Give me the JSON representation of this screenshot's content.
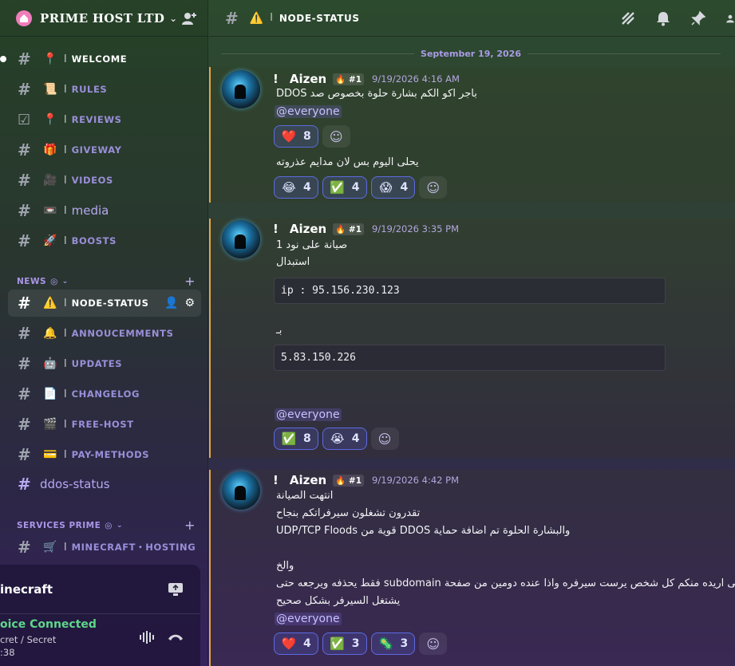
{
  "server": {
    "name": "PRIME HOST LTD"
  },
  "sidebar": {
    "channels_top": [
      {
        "emoji": "📍",
        "label": "WELCOME",
        "style": "bright",
        "unread": true
      },
      {
        "emoji": "📜",
        "label": "RULES"
      },
      {
        "emoji": "📍",
        "label": "REVIEWS",
        "icon": "checklist"
      },
      {
        "emoji": "🎁",
        "label": "GIVEWAY"
      },
      {
        "emoji": "🎥",
        "label": "VIDEOS"
      },
      {
        "emoji": "📼",
        "label": "media",
        "plain": true
      },
      {
        "emoji": "🚀",
        "label": "BOOSTS"
      }
    ],
    "category_news": "NEWS",
    "channels_news": [
      {
        "emoji": "⚠️",
        "label": "NODE-STATUS",
        "active": true
      },
      {
        "emoji": "🔔",
        "label": "ANNOUCEMMENTS"
      },
      {
        "emoji": "🤖",
        "label": "UPDATES"
      },
      {
        "emoji": "📄",
        "label": "CHANGELOG"
      },
      {
        "emoji": "🎬",
        "label": "FREE-HOST"
      },
      {
        "emoji": "💳",
        "label": "PAY-METHODS"
      }
    ],
    "ddos_channel": "ddos-status",
    "category_services": "SERVICES PRIME",
    "channel_minecraft": {
      "emoji": "🛒",
      "label": "MINECRAFT・HOSTING"
    }
  },
  "voice": {
    "title": "inecraft",
    "status": "oice Connected",
    "sub": "cret / Secret",
    "time": ":38"
  },
  "topbar": {
    "channel": "NODE-STATUS"
  },
  "date_separator": "September 19, 2026",
  "messages": [
    {
      "author": "Aizen",
      "tag": "🔥 #1",
      "time": "9/19/2026 4:16 AM",
      "line1": "باجر اكو الكم بشارة حلوة بخصوص صد DDOS",
      "mention": "@everyone",
      "reactions1": [
        {
          "emoji": "❤️",
          "count": "8"
        }
      ],
      "line2": "يحلى اليوم بس لان مدايم عذروته",
      "reactions2": [
        {
          "emoji": "😂",
          "count": "4"
        },
        {
          "emoji": "✅",
          "count": "4"
        },
        {
          "emoji": "😱",
          "count": "4"
        }
      ]
    },
    {
      "author": "Aizen",
      "tag": "🔥 #1",
      "time": "9/19/2026 3:35 PM",
      "line1": "صيانة على نود 1",
      "line2": "استبدال",
      "code1": "ip : 95.156.230.123",
      "line3": "بـ",
      "code2": "5.83.150.226",
      "mention": "@everyone",
      "reactions": [
        {
          "emoji": "✅",
          "count": "8"
        },
        {
          "emoji": "😭",
          "count": "4"
        }
      ]
    },
    {
      "author": "Aizen",
      "tag": "🔥 #1",
      "time": "9/19/2026 4:42 PM",
      "line1": "انتهت الصيانة",
      "line2": "تقدرون تشغلون سيرفراتكم بنجاح",
      "line3": "والبشارة الحلوة تم اضافة حماية DDOS قوية من UDP/TCP Floods",
      "line4": "والخ",
      "line5": "اللى اريده منكم كل شخص يرست سيرفره واذا عنده دومين من صفحة subdomain فقط يحذفه ويرجعه حتى",
      "line6": "يشتغل السيرفر بشكل صحيح",
      "mention": "@everyone",
      "reactions": [
        {
          "emoji": "❤️",
          "count": "4"
        },
        {
          "emoji": "✅",
          "count": "3"
        },
        {
          "emoji": "🦠",
          "count": "3"
        }
      ]
    }
  ],
  "colors": {
    "accent": "#5c6be0",
    "mention_bar": "#e3a648",
    "voice_green": "#5ed78a"
  }
}
